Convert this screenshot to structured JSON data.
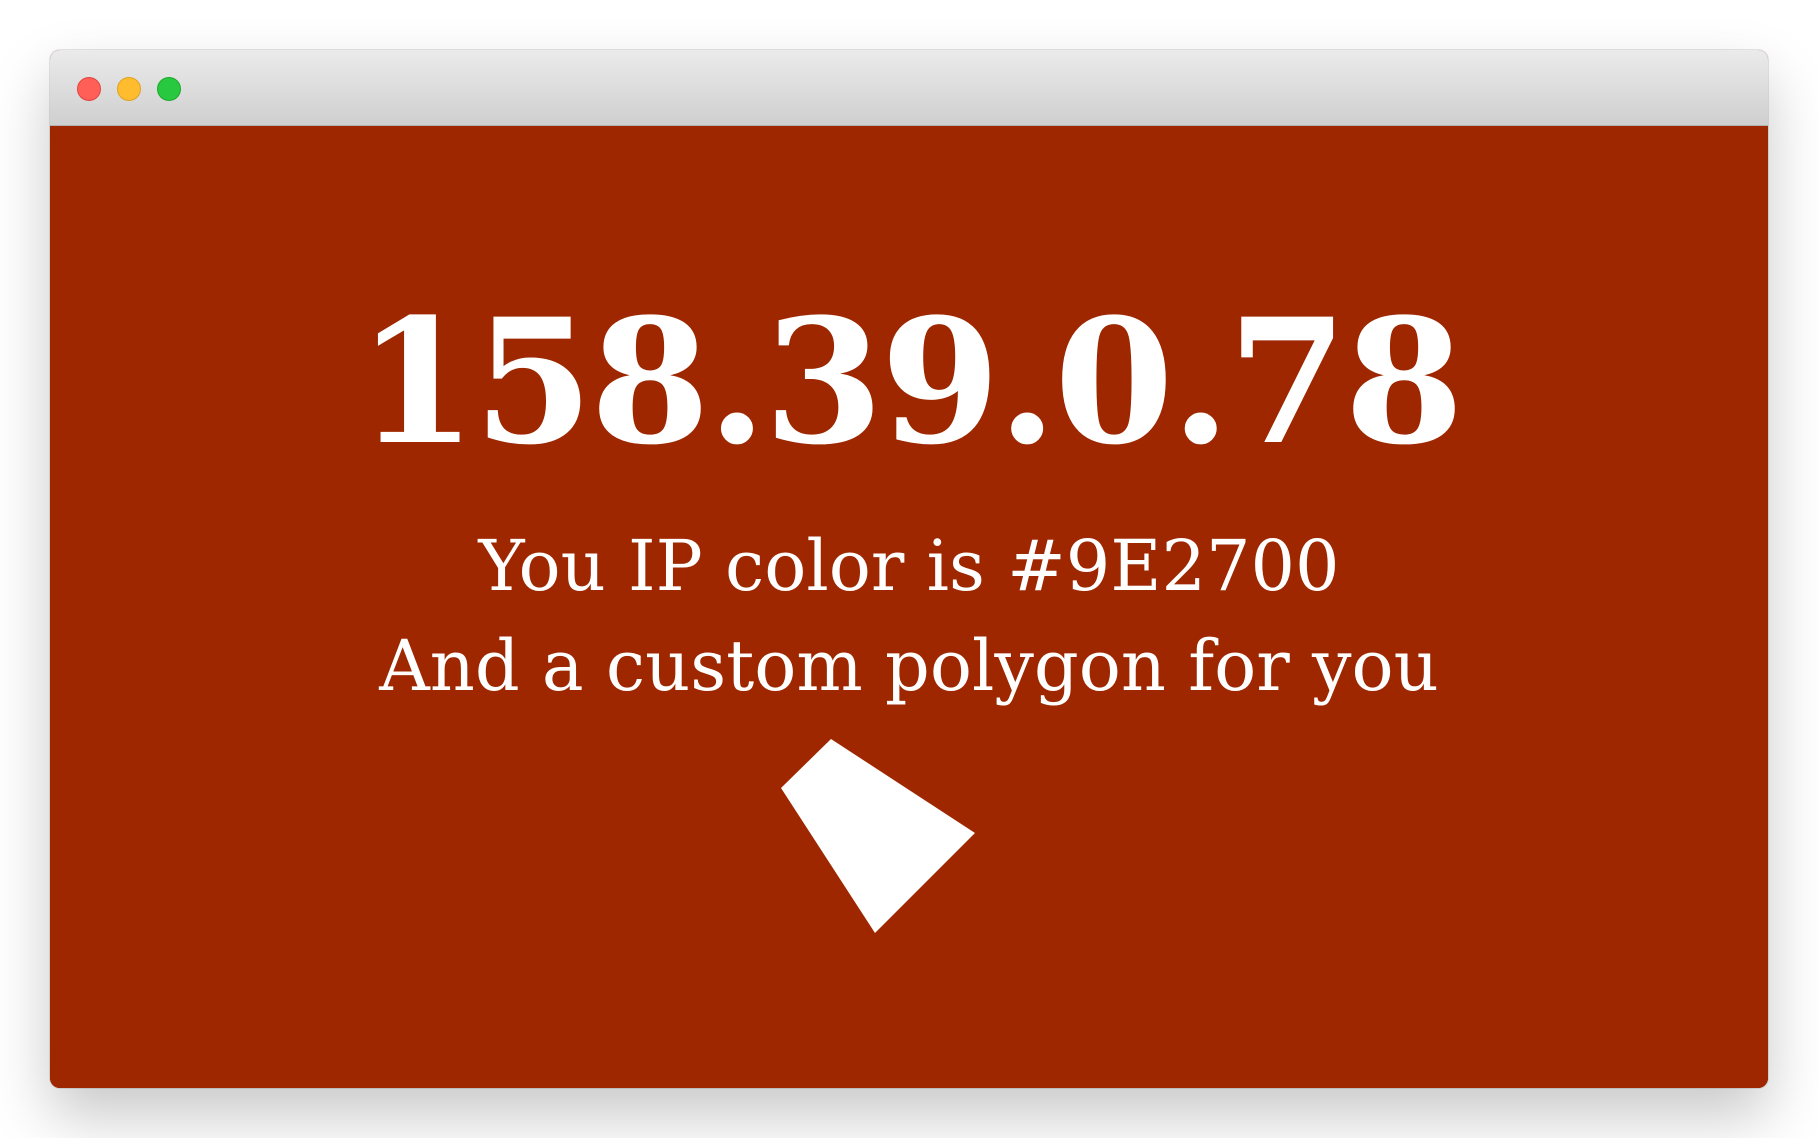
{
  "window": {
    "traffic_lights": {
      "close_color": "#FF5F57",
      "minimize_color": "#FEBC2E",
      "maximize_color": "#28C840"
    }
  },
  "page": {
    "background_color": "#9E2700",
    "ip_address": "158.39.0.78",
    "color_text": "You IP color is #9E2700",
    "polygon_text": "And a custom polygon for you",
    "polygon_color": "#FFFFFF"
  }
}
